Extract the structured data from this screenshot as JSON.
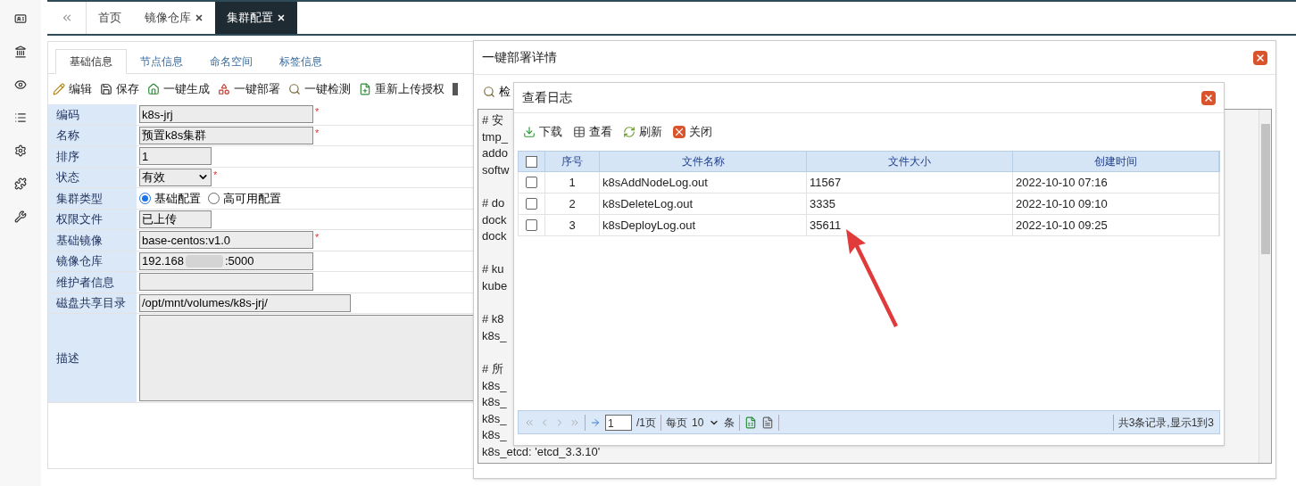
{
  "tabs": [
    {
      "label": "首页",
      "closable": false,
      "selected": false
    },
    {
      "label": "镜像仓库",
      "closable": true,
      "selected": false
    },
    {
      "label": "集群配置",
      "closable": true,
      "selected": true
    }
  ],
  "sub_tabs": [
    {
      "label": "基础信息",
      "selected": true
    },
    {
      "label": "节点信息",
      "selected": false
    },
    {
      "label": "命名空间",
      "selected": false
    },
    {
      "label": "标签信息",
      "selected": false
    }
  ],
  "toolbar": [
    {
      "label": "编辑",
      "kind": "edit"
    },
    {
      "label": "保存",
      "kind": "save"
    },
    {
      "label": "一键生成",
      "kind": "generate"
    },
    {
      "label": "一键部署",
      "kind": "deploy"
    },
    {
      "label": "一键检测",
      "kind": "check"
    },
    {
      "label": "重新上传授权",
      "kind": "upload"
    }
  ],
  "form": [
    {
      "label": "编码",
      "kind": "text",
      "value": "k8s-jrj",
      "required_mark": "*"
    },
    {
      "label": "名称",
      "kind": "text",
      "value": "预置k8s集群",
      "required_mark": "*"
    },
    {
      "label": "排序",
      "kind": "short",
      "value": "1"
    },
    {
      "label": "状态",
      "kind": "select",
      "value": "有效",
      "required_mark": "*"
    },
    {
      "label": "集群类型",
      "kind": "radio",
      "options": [
        {
          "label": "基础配置",
          "selected": true
        },
        {
          "label": "高可用配置",
          "selected": false
        }
      ]
    },
    {
      "label": "权限文件",
      "kind": "short",
      "value": "已上传"
    },
    {
      "label": "基础镜像",
      "kind": "text",
      "value": "base-centos:v1.0",
      "required_mark": "*"
    },
    {
      "label": "镜像仓库",
      "kind": "redacted",
      "value": "192.168",
      "suffix": ":5000"
    },
    {
      "label": "维护者信息",
      "kind": "text"
    },
    {
      "label": "磁盘共享目录",
      "kind": "long",
      "value": "/opt/mnt/volumes/k8s-jrj/"
    },
    {
      "label": "描述",
      "kind": "textarea"
    }
  ],
  "deploy_dialog": {
    "title": "一键部署详情",
    "toolbar_label": "检",
    "log_blocks": [
      [
        "# 安",
        "tmp_",
        "addo",
        "softw"
      ],
      [
        "# do",
        "dock",
        "dock"
      ],
      [
        "# ku",
        "kube"
      ],
      [
        "# k8",
        "k8s_"
      ],
      [
        "# 所",
        "k8s_",
        "k8s_",
        "k8s_",
        "k8s_",
        "k8s_etcd: 'etcd_3.3.10'"
      ]
    ]
  },
  "log_dialog": {
    "title": "查看日志",
    "toolbar": [
      {
        "label": "下载",
        "kind": "download"
      },
      {
        "label": "查看",
        "kind": "view"
      },
      {
        "label": "刷新",
        "kind": "refresh"
      },
      {
        "label": "关闭",
        "kind": "close"
      }
    ],
    "table": {
      "all_checked": false,
      "columns": [
        "序号",
        "文件名称",
        "文件大小",
        "创建时间"
      ],
      "rows": [
        {
          "checked": false,
          "cells": [
            "1",
            "k8sAddNodeLog.out",
            "11567",
            "2022-10-10 07:16"
          ]
        },
        {
          "checked": false,
          "cells": [
            "2",
            "k8sDeleteLog.out",
            "3335",
            "2022-10-10 09:10"
          ]
        },
        {
          "checked": false,
          "cells": [
            "3",
            "k8sDeployLog.out",
            "35611",
            "2022-10-10 09:25"
          ]
        }
      ]
    },
    "pager": {
      "page": "1",
      "total_pages": "/1页",
      "per_page_label": "每页",
      "per_page": "10",
      "unit": "条",
      "summary": "共3条记录,显示1到3"
    }
  }
}
